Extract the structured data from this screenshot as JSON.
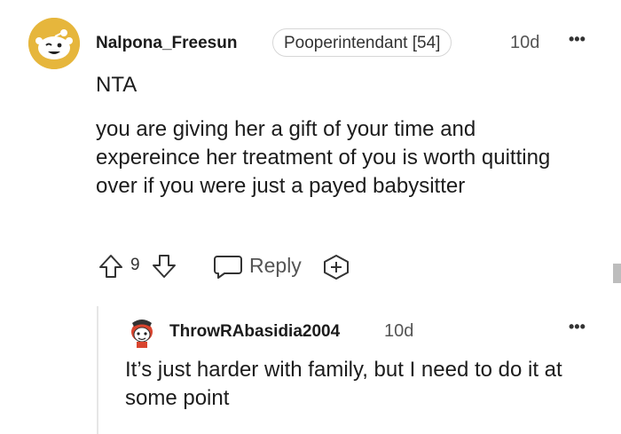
{
  "comment": {
    "username": "Nalpona_Freesun",
    "flair": "Pooperintendant [54]",
    "time": "10d",
    "more_glyph": "•••",
    "verdict": "NTA",
    "body": "you are giving her a gift of your time and expereince her treatment of you is worth quitting over if you were just a payed babysitter",
    "vote_count": "9",
    "reply_label": "Reply"
  },
  "reply": {
    "username": "ThrowRAbasidia2004",
    "time": "10d",
    "more_glyph": "•••",
    "body": "It’s just harder with family, but I need to do it at some point"
  },
  "colors": {
    "avatar_bg": "#e6b63c",
    "thread_line": "#e6e6e6"
  },
  "icons": [
    "snoo-avatar-icon",
    "upvote-icon",
    "downvote-icon",
    "reply-bubble-icon",
    "award-plus-icon",
    "snoo-avatar-small-icon",
    "more-options-icon"
  ]
}
